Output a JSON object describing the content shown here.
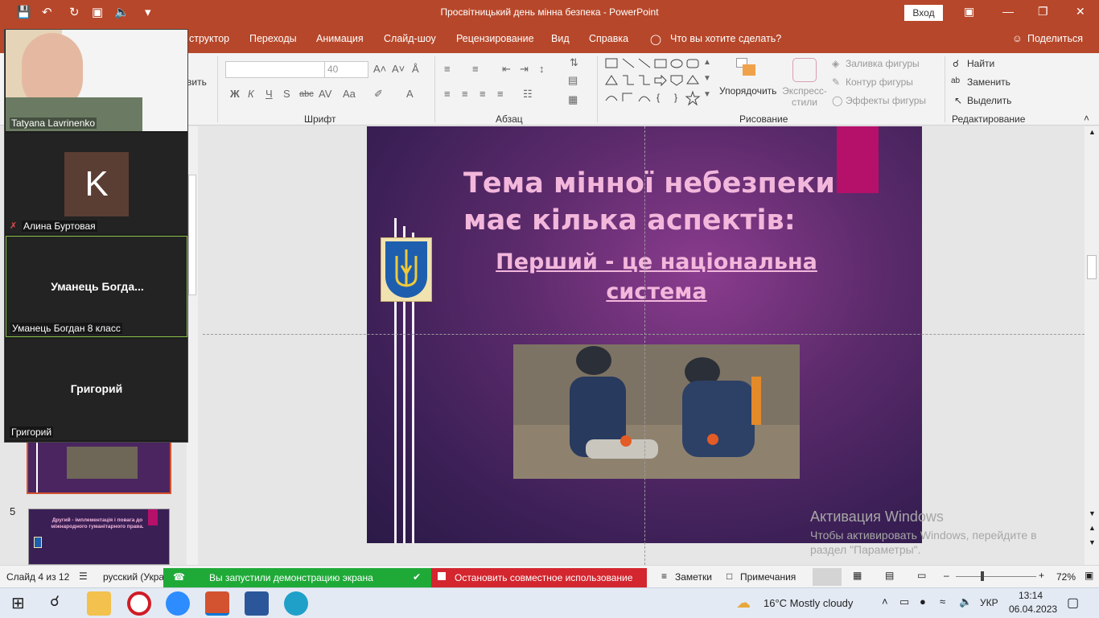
{
  "window": {
    "title": "Просвітницький день мінна безпека  -  PowerPoint",
    "signin": "Вход"
  },
  "menu": {
    "items": [
      "структор",
      "Переходы",
      "Анимация",
      "Слайд-шоу",
      "Рецензирование",
      "Вид",
      "Справка",
      "Что вы хотите сделать?"
    ],
    "share": "Поделиться"
  },
  "ribbon": {
    "partial_label": "вить",
    "font_size": "40",
    "groups": {
      "font": "Шрифт",
      "paragraph": "Абзац",
      "drawing": "Рисование",
      "editing": "Редактирование"
    },
    "arrange": "Упорядочить",
    "quick_styles": "Экспресс-\nстили",
    "shape_fill": "Заливка фигуры",
    "shape_outline": "Контур фигуры",
    "shape_effects": "Эффекты фигуры",
    "find": "Найти",
    "replace": "Заменить",
    "select": "Выделить"
  },
  "thumbnails": {
    "slide5_number": "5",
    "slide5_text": "Другий - імплементація і повага до міжнародного гуманітарного права."
  },
  "slide": {
    "title_line1": "Тема мінної небезпеки",
    "title_line2": "має кілька аспектів:",
    "subtitle_line1": "Перший - це національна",
    "subtitle_line2": "система"
  },
  "activation": {
    "title": "Активация Windows",
    "line1": "Чтобы активировать Windows, перейдите в",
    "line2": "раздел \"Параметры\"."
  },
  "status": {
    "slide_info": "Слайд 4 из 12",
    "language": "русский (Укра",
    "screen_share": "Вы запустили демонстрацию экрана",
    "stop_share": "Остановить совместное использование",
    "notes": "Заметки",
    "comments": "Примечания",
    "zoom": "72%"
  },
  "zoom_participants": [
    {
      "name": "Tatyana Lavrinenko"
    },
    {
      "name": "Алина Буртовая",
      "initial": "K"
    },
    {
      "name": "Уманець Богдан 8 класс",
      "center": "Уманець  Богда..."
    },
    {
      "name": "Григорий",
      "center": "Григорий"
    }
  ],
  "taskbar": {
    "weather": "16°C  Mostly cloudy",
    "lang": "УКР",
    "time": "13:14",
    "date": "06.04.2023"
  }
}
